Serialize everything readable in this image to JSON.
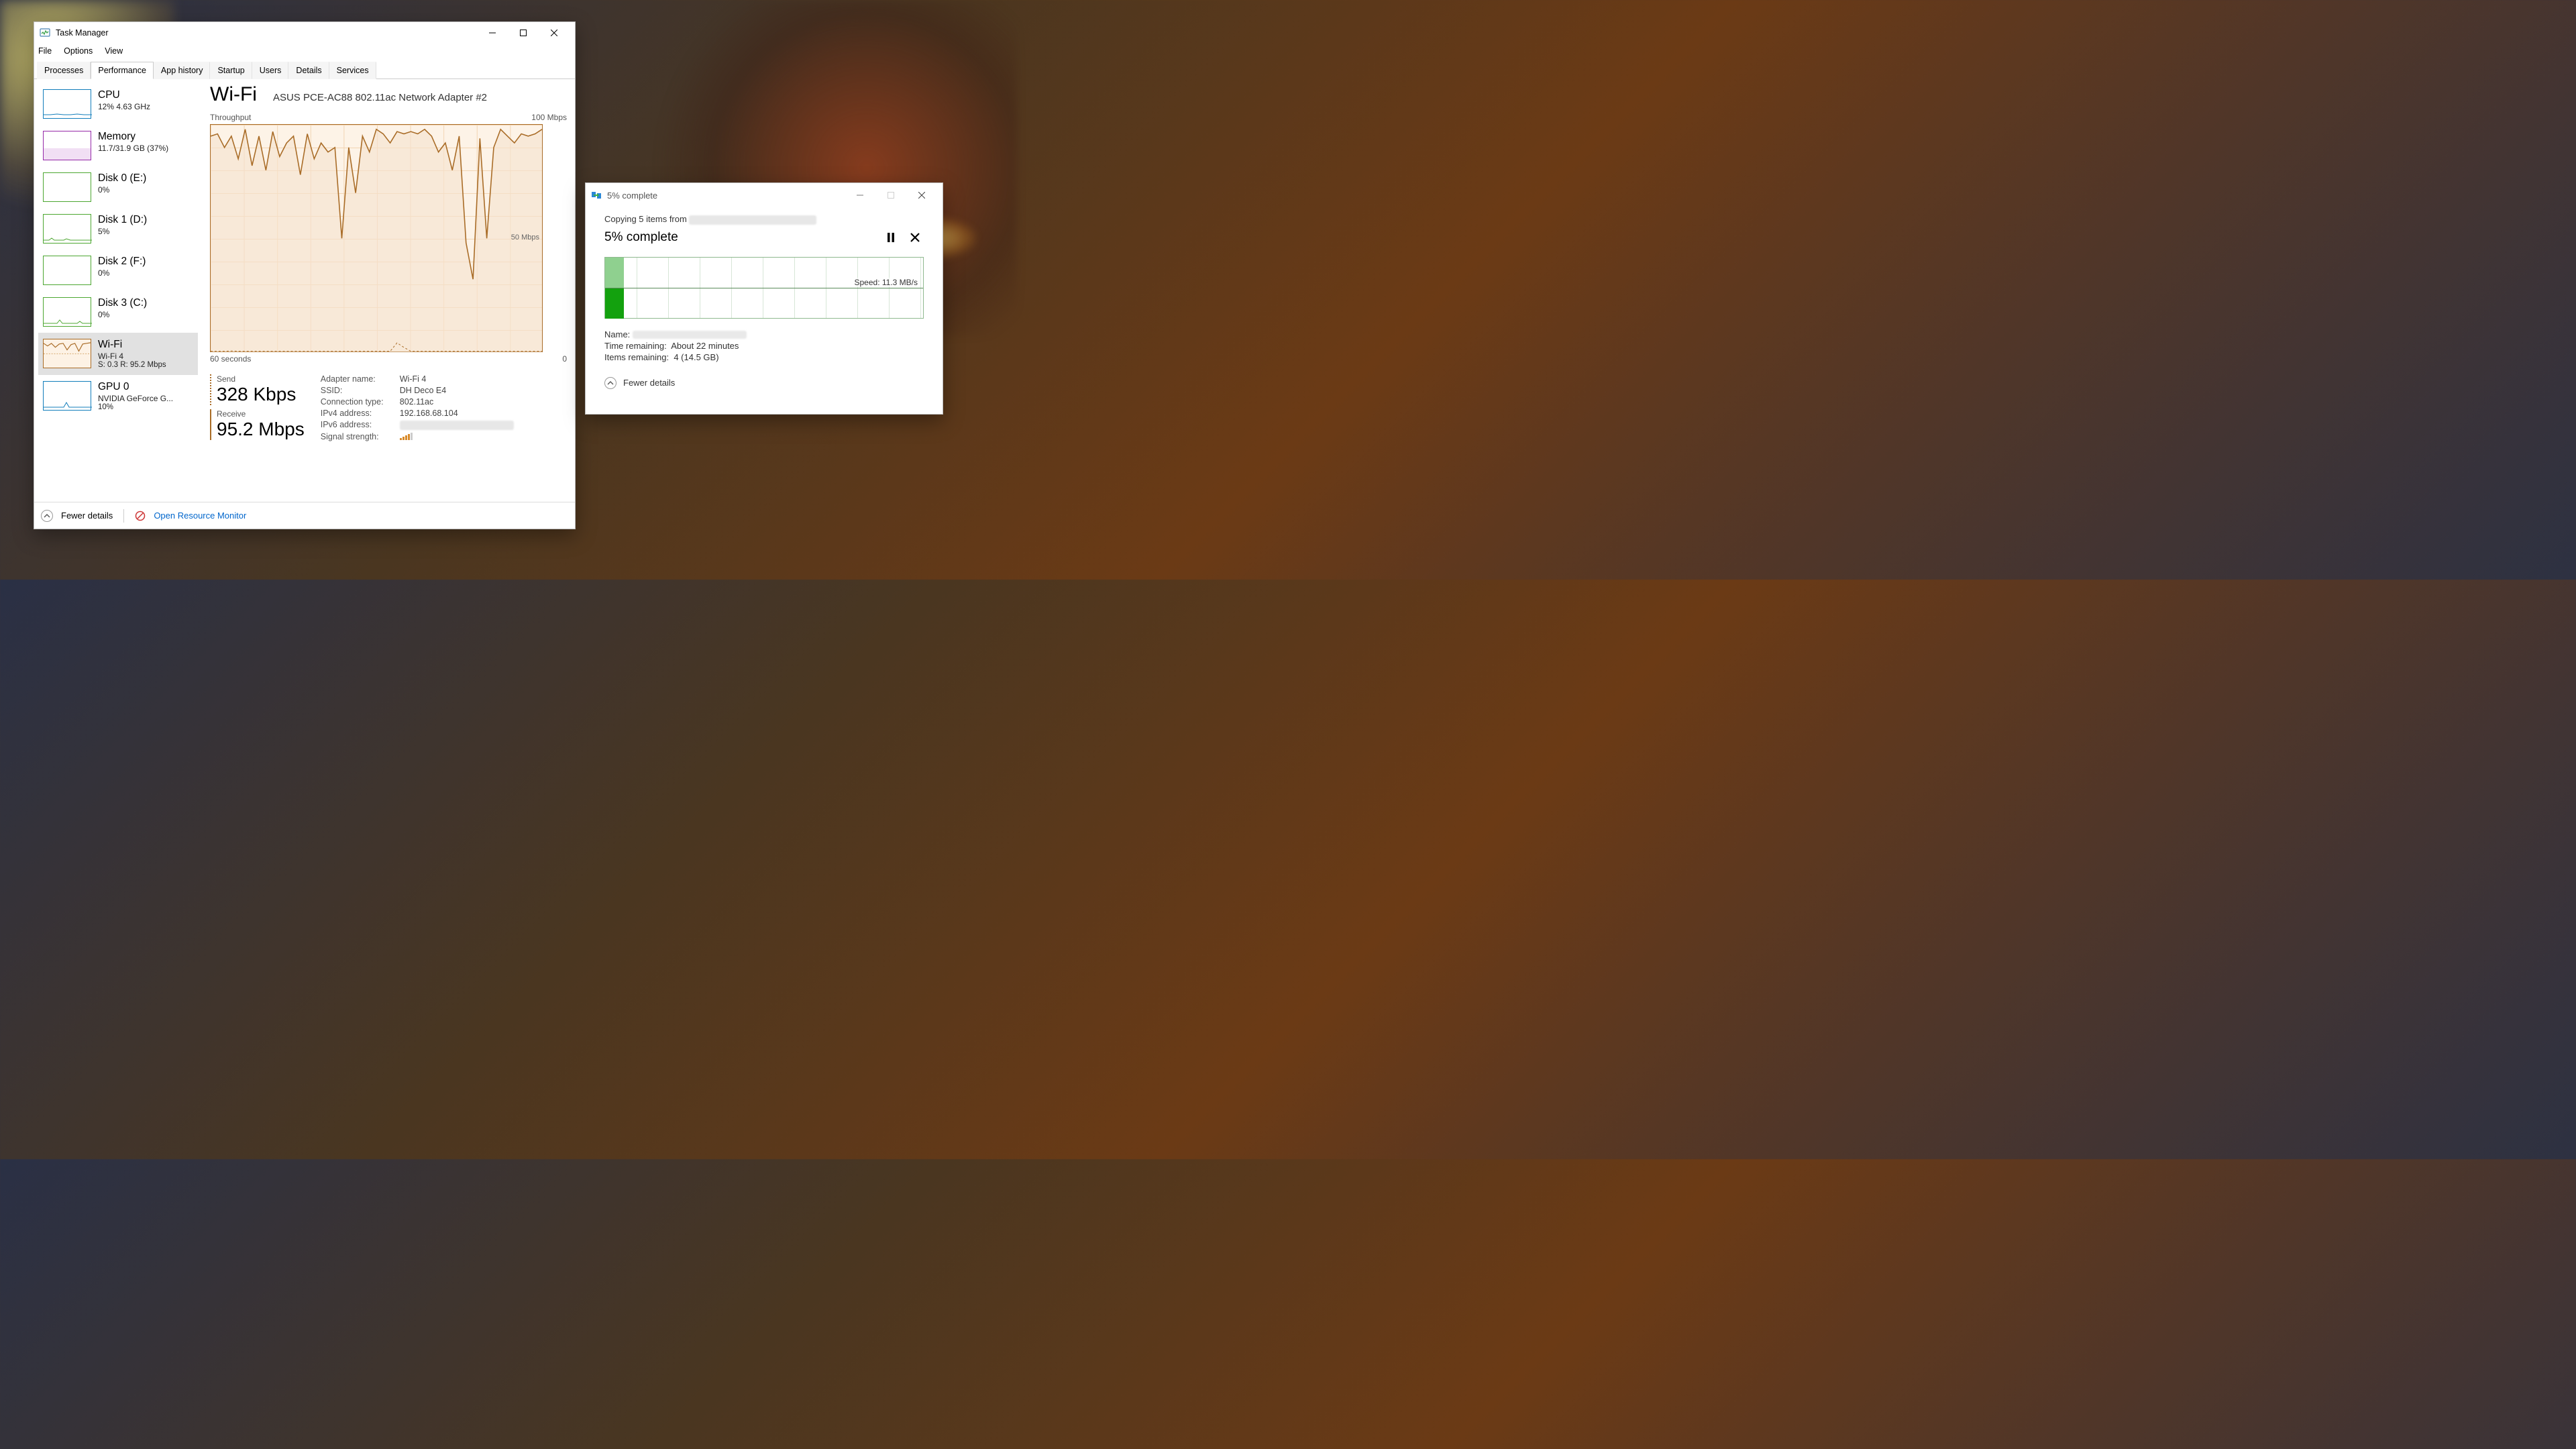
{
  "task_manager": {
    "title": "Task Manager",
    "menus": {
      "file": "File",
      "options": "Options",
      "view": "View"
    },
    "tabs": {
      "processes": "Processes",
      "performance": "Performance",
      "app_history": "App history",
      "startup": "Startup",
      "users": "Users",
      "details": "Details",
      "services": "Services"
    },
    "active_tab": "performance",
    "sidebar": [
      {
        "title": "CPU",
        "sub": "12% 4.63 GHz"
      },
      {
        "title": "Memory",
        "sub": "11.7/31.9 GB (37%)"
      },
      {
        "title": "Disk 0 (E:)",
        "sub": "0%"
      },
      {
        "title": "Disk 1 (D:)",
        "sub": "5%"
      },
      {
        "title": "Disk 2 (F:)",
        "sub": "0%"
      },
      {
        "title": "Disk 3 (C:)",
        "sub": "0%"
      },
      {
        "title": "Wi-Fi",
        "sub": "Wi-Fi 4",
        "sub2": "S: 0.3 R: 95.2 Mbps"
      },
      {
        "title": "GPU 0",
        "sub": "NVIDIA GeForce G...",
        "sub2": "10%"
      }
    ],
    "main": {
      "heading": "Wi-Fi",
      "adapter": "ASUS PCE-AC88 802.11ac Network Adapter #2",
      "chart_top_left": "Throughput",
      "chart_top_right": "100 Mbps",
      "chart_mid": "50 Mbps",
      "chart_bot_left": "60 seconds",
      "chart_bot_right": "0",
      "send_label": "Send",
      "send_value": "328 Kbps",
      "recv_label": "Receive",
      "recv_value": "95.2 Mbps",
      "kv": {
        "adapter_name_k": "Adapter name:",
        "adapter_name_v": "Wi-Fi 4",
        "ssid_k": "SSID:",
        "ssid_v": "DH Deco E4",
        "conn_k": "Connection type:",
        "conn_v": "802.11ac",
        "ipv4_k": "IPv4 address:",
        "ipv4_v": "192.168.68.104",
        "ipv6_k": "IPv6 address:",
        "ipv6_v": "",
        "sig_k": "Signal strength:"
      }
    },
    "footer": {
      "fewer": "Fewer details",
      "open_rm": "Open Resource Monitor"
    }
  },
  "copy_dialog": {
    "title": "5% complete",
    "line1_prefix": "Copying 5 items from ",
    "heading": "5% complete",
    "speed": "Speed: 11.3 MB/s",
    "name_k": "Name:",
    "time_k": "Time remaining:",
    "time_v": "About 22 minutes",
    "items_k": "Items remaining:",
    "items_v": "4 (14.5 GB)",
    "fewer": "Fewer details"
  },
  "chart_data": {
    "type": "line",
    "title": "Wi-Fi Throughput",
    "xlabel": "seconds ago",
    "ylabel": "Mbps",
    "ylim": [
      0,
      100
    ],
    "xlim": [
      60,
      0
    ],
    "series": [
      {
        "name": "Receive",
        "values": [
          95,
          96,
          90,
          95,
          85,
          98,
          82,
          95,
          80,
          97,
          86,
          92,
          95,
          78,
          96,
          85,
          92,
          88,
          90,
          50,
          90,
          70,
          95,
          88,
          98,
          96,
          92,
          97,
          96,
          97,
          96,
          98,
          95,
          88,
          92,
          80,
          95,
          48,
          32,
          94,
          50,
          90,
          98,
          95,
          92,
          96,
          95,
          96,
          98
        ]
      },
      {
        "name": "Send",
        "values": [
          0.3,
          0.3,
          0.3,
          0.4,
          0.3,
          0.3,
          0.3,
          0.3,
          0.3,
          0.3,
          0.3,
          0.3,
          0.3,
          0.3,
          0.3,
          0.3,
          0.3,
          0.3,
          0.3,
          0.3,
          0.3,
          0.3,
          0.3,
          0.3,
          0.3,
          0.3,
          0.3,
          4,
          2,
          0.3,
          0.3,
          0.3,
          0.3,
          0.3,
          0.3,
          0.3,
          0.3,
          0.3,
          0.3,
          0.3,
          0.3,
          0.3,
          0.3,
          0.3,
          0.3,
          0.3,
          0.3,
          0.3,
          0.3
        ]
      }
    ]
  }
}
